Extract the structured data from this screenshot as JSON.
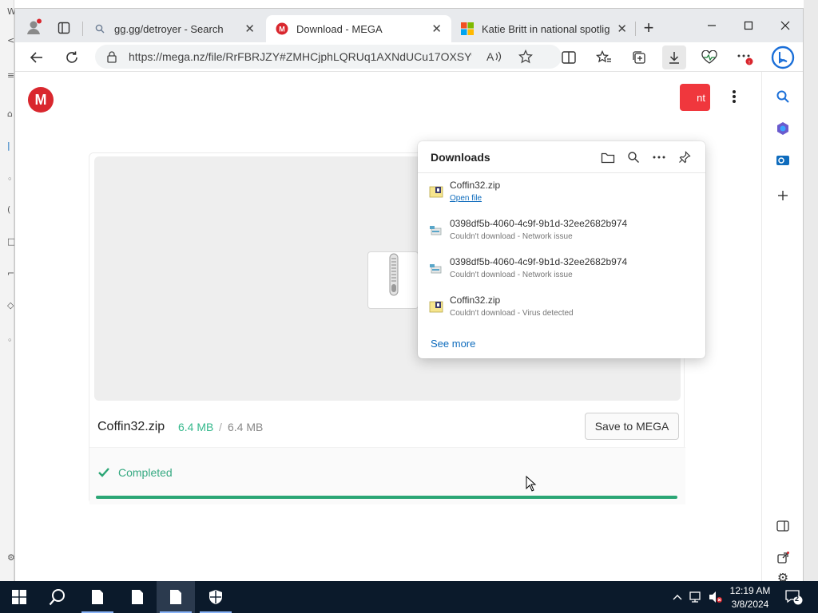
{
  "browser": {
    "tabs": [
      {
        "title": "",
        "kind": "profile"
      },
      {
        "title": "gg.gg/detroyer - Search",
        "favicon": "search-icon"
      },
      {
        "title": "Download - MEGA",
        "favicon": "mega-icon",
        "active": true
      },
      {
        "title": "Katie Britt in national spotlight",
        "favicon": "msn-icon"
      }
    ],
    "new_tab_label": "+",
    "address_url": "https://mega.nz/file/RrFBRJZY#ZMHCjphLQRUq1AXNdUCu17OXSYf..."
  },
  "page": {
    "logo_letter": "M",
    "red_button_text": "nt",
    "file": {
      "name": "Coffin32.zip",
      "size_done": "6.4 MB",
      "size_sep": "/",
      "size_total": "6.4 MB",
      "save_label": "Save to MEGA",
      "status": "Completed",
      "progress": 1.0
    }
  },
  "downloads": {
    "title": "Downloads",
    "items": [
      {
        "name": "Coffin32.zip",
        "sub": "Open file",
        "sub_is_link": true,
        "icon": "zip-file-icon"
      },
      {
        "name": "0398df5b-4060-4c9f-9b1d-32ee2682b974",
        "sub": "Couldn't download - Network issue",
        "icon": "unknown-file-icon"
      },
      {
        "name": "0398df5b-4060-4c9f-9b1d-32ee2682b974",
        "sub": "Couldn't download - Network issue",
        "icon": "unknown-file-icon"
      },
      {
        "name": "Coffin32.zip",
        "sub": "Couldn't download - Virus detected",
        "icon": "zip-file-icon"
      }
    ],
    "see_more": "See more"
  },
  "taskbar": {
    "time": "12:19 AM",
    "date": "3/8/2024",
    "notification_count": "2"
  },
  "colors": {
    "mega_red": "#d9272e",
    "success_green": "#2ba675",
    "link_blue": "#0f6cbd",
    "taskbar_bg": "#0b1a2b"
  }
}
